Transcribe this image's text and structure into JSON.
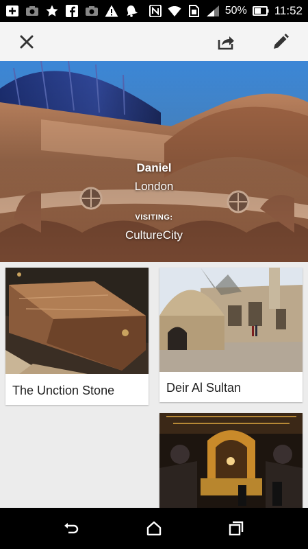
{
  "status_bar": {
    "battery_percent": "50%",
    "time": "11:52",
    "left_icons": [
      "add-box-icon",
      "camera-icon",
      "star-icon",
      "facebook-icon",
      "camera-icon",
      "alert-icon",
      "bell-icon"
    ],
    "right_icons": [
      "nfc-icon",
      "wifi-icon",
      "sim-icon",
      "signal-icon",
      "battery-icon"
    ]
  },
  "toolbar": {
    "close_icon": "close-icon",
    "share_icon": "share-icon",
    "edit_icon": "edit-icon"
  },
  "hero": {
    "name": "Daniel",
    "city": "London",
    "visiting_label": "VISITING:",
    "place": "CultureCity"
  },
  "cards": [
    {
      "title": "The Unction Stone",
      "image": "unction-stone-photo"
    },
    {
      "title": "Deir Al Sultan",
      "image": "deir-al-sultan-photo"
    },
    {
      "title": "",
      "image": "golgotha-altar-photo"
    }
  ],
  "nav_bar": {
    "icons": [
      "back-icon",
      "home-icon",
      "recents-icon"
    ]
  },
  "colors": {
    "status_bar": "#000000",
    "toolbar": "#f4f4f4",
    "background": "#ececec",
    "icon": "#333333"
  }
}
